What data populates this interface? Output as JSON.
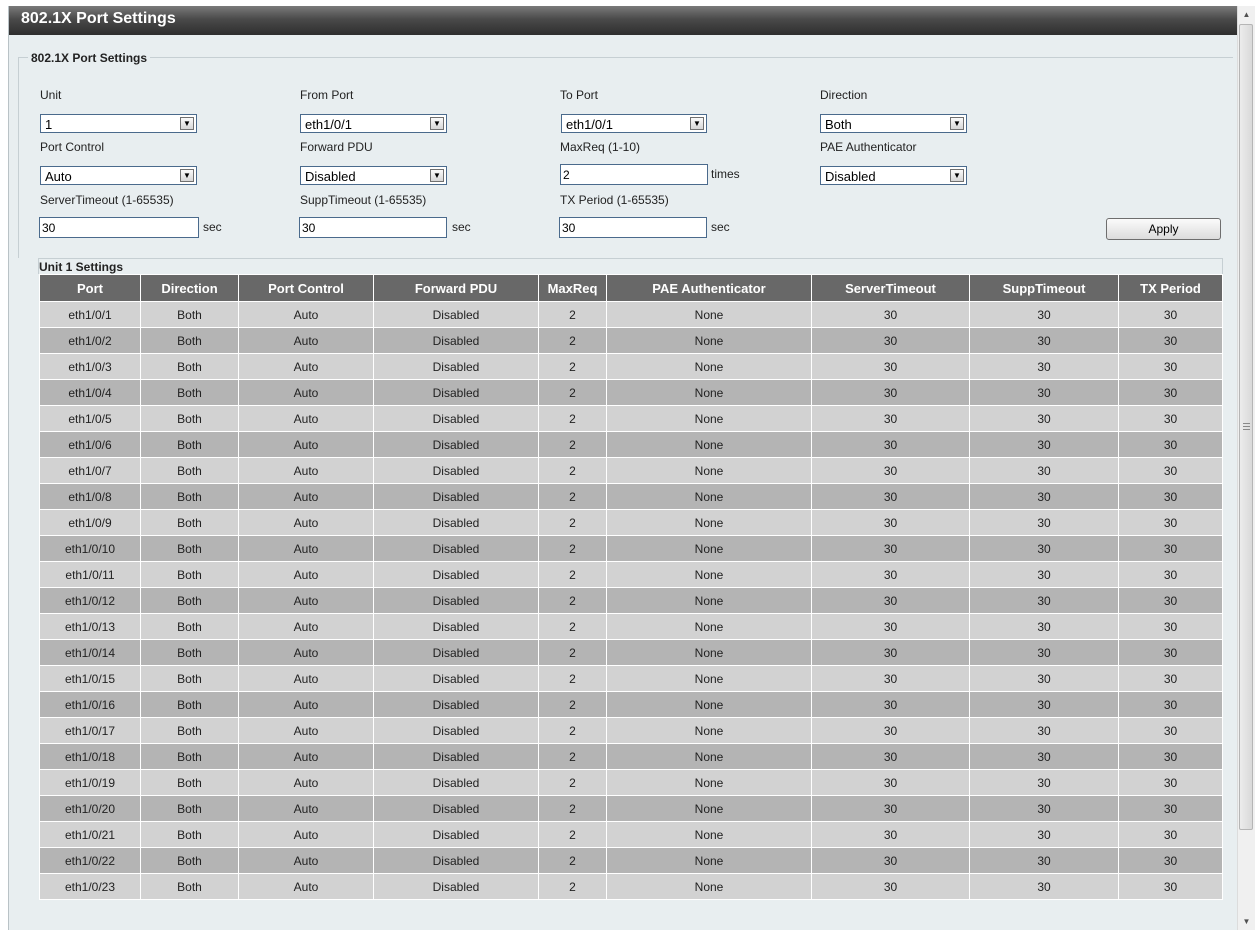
{
  "title": "802.1X Port Settings",
  "fieldset_legend": "802.1X Port Settings",
  "form": {
    "unit": {
      "label": "Unit",
      "value": "1"
    },
    "from_port": {
      "label": "From Port",
      "value": "eth1/0/1"
    },
    "to_port": {
      "label": "To Port",
      "value": "eth1/0/1"
    },
    "direction": {
      "label": "Direction",
      "value": "Both"
    },
    "port_control": {
      "label": "Port Control",
      "value": "Auto"
    },
    "forward_pdu": {
      "label": "Forward PDU",
      "value": "Disabled"
    },
    "maxreq": {
      "label": "MaxReq (1-10)",
      "value": "2",
      "unit": "times"
    },
    "pae_authenticator": {
      "label": "PAE Authenticator",
      "value": "Disabled"
    },
    "server_timeout": {
      "label": "ServerTimeout (1-65535)",
      "value": "30",
      "unit": "sec"
    },
    "supp_timeout": {
      "label": "SuppTimeout (1-65535)",
      "value": "30",
      "unit": "sec"
    },
    "tx_period": {
      "label": "TX Period (1-65535)",
      "value": "30",
      "unit": "sec"
    },
    "apply_label": "Apply"
  },
  "table": {
    "caption": "Unit 1 Settings",
    "columns": [
      "Port",
      "Direction",
      "Port Control",
      "Forward PDU",
      "MaxReq",
      "PAE Authenticator",
      "ServerTimeout",
      "SuppTimeout",
      "TX Period"
    ],
    "rows": [
      [
        "eth1/0/1",
        "Both",
        "Auto",
        "Disabled",
        "2",
        "None",
        "30",
        "30",
        "30"
      ],
      [
        "eth1/0/2",
        "Both",
        "Auto",
        "Disabled",
        "2",
        "None",
        "30",
        "30",
        "30"
      ],
      [
        "eth1/0/3",
        "Both",
        "Auto",
        "Disabled",
        "2",
        "None",
        "30",
        "30",
        "30"
      ],
      [
        "eth1/0/4",
        "Both",
        "Auto",
        "Disabled",
        "2",
        "None",
        "30",
        "30",
        "30"
      ],
      [
        "eth1/0/5",
        "Both",
        "Auto",
        "Disabled",
        "2",
        "None",
        "30",
        "30",
        "30"
      ],
      [
        "eth1/0/6",
        "Both",
        "Auto",
        "Disabled",
        "2",
        "None",
        "30",
        "30",
        "30"
      ],
      [
        "eth1/0/7",
        "Both",
        "Auto",
        "Disabled",
        "2",
        "None",
        "30",
        "30",
        "30"
      ],
      [
        "eth1/0/8",
        "Both",
        "Auto",
        "Disabled",
        "2",
        "None",
        "30",
        "30",
        "30"
      ],
      [
        "eth1/0/9",
        "Both",
        "Auto",
        "Disabled",
        "2",
        "None",
        "30",
        "30",
        "30"
      ],
      [
        "eth1/0/10",
        "Both",
        "Auto",
        "Disabled",
        "2",
        "None",
        "30",
        "30",
        "30"
      ],
      [
        "eth1/0/11",
        "Both",
        "Auto",
        "Disabled",
        "2",
        "None",
        "30",
        "30",
        "30"
      ],
      [
        "eth1/0/12",
        "Both",
        "Auto",
        "Disabled",
        "2",
        "None",
        "30",
        "30",
        "30"
      ],
      [
        "eth1/0/13",
        "Both",
        "Auto",
        "Disabled",
        "2",
        "None",
        "30",
        "30",
        "30"
      ],
      [
        "eth1/0/14",
        "Both",
        "Auto",
        "Disabled",
        "2",
        "None",
        "30",
        "30",
        "30"
      ],
      [
        "eth1/0/15",
        "Both",
        "Auto",
        "Disabled",
        "2",
        "None",
        "30",
        "30",
        "30"
      ],
      [
        "eth1/0/16",
        "Both",
        "Auto",
        "Disabled",
        "2",
        "None",
        "30",
        "30",
        "30"
      ],
      [
        "eth1/0/17",
        "Both",
        "Auto",
        "Disabled",
        "2",
        "None",
        "30",
        "30",
        "30"
      ],
      [
        "eth1/0/18",
        "Both",
        "Auto",
        "Disabled",
        "2",
        "None",
        "30",
        "30",
        "30"
      ],
      [
        "eth1/0/19",
        "Both",
        "Auto",
        "Disabled",
        "2",
        "None",
        "30",
        "30",
        "30"
      ],
      [
        "eth1/0/20",
        "Both",
        "Auto",
        "Disabled",
        "2",
        "None",
        "30",
        "30",
        "30"
      ],
      [
        "eth1/0/21",
        "Both",
        "Auto",
        "Disabled",
        "2",
        "None",
        "30",
        "30",
        "30"
      ],
      [
        "eth1/0/22",
        "Both",
        "Auto",
        "Disabled",
        "2",
        "None",
        "30",
        "30",
        "30"
      ],
      [
        "eth1/0/23",
        "Both",
        "Auto",
        "Disabled",
        "2",
        "None",
        "30",
        "30",
        "30"
      ]
    ]
  },
  "icons": {
    "dropdown": "chevron-down-icon",
    "scroll_up": "scroll-up-arrow-icon",
    "scroll_down": "scroll-down-arrow-icon"
  }
}
